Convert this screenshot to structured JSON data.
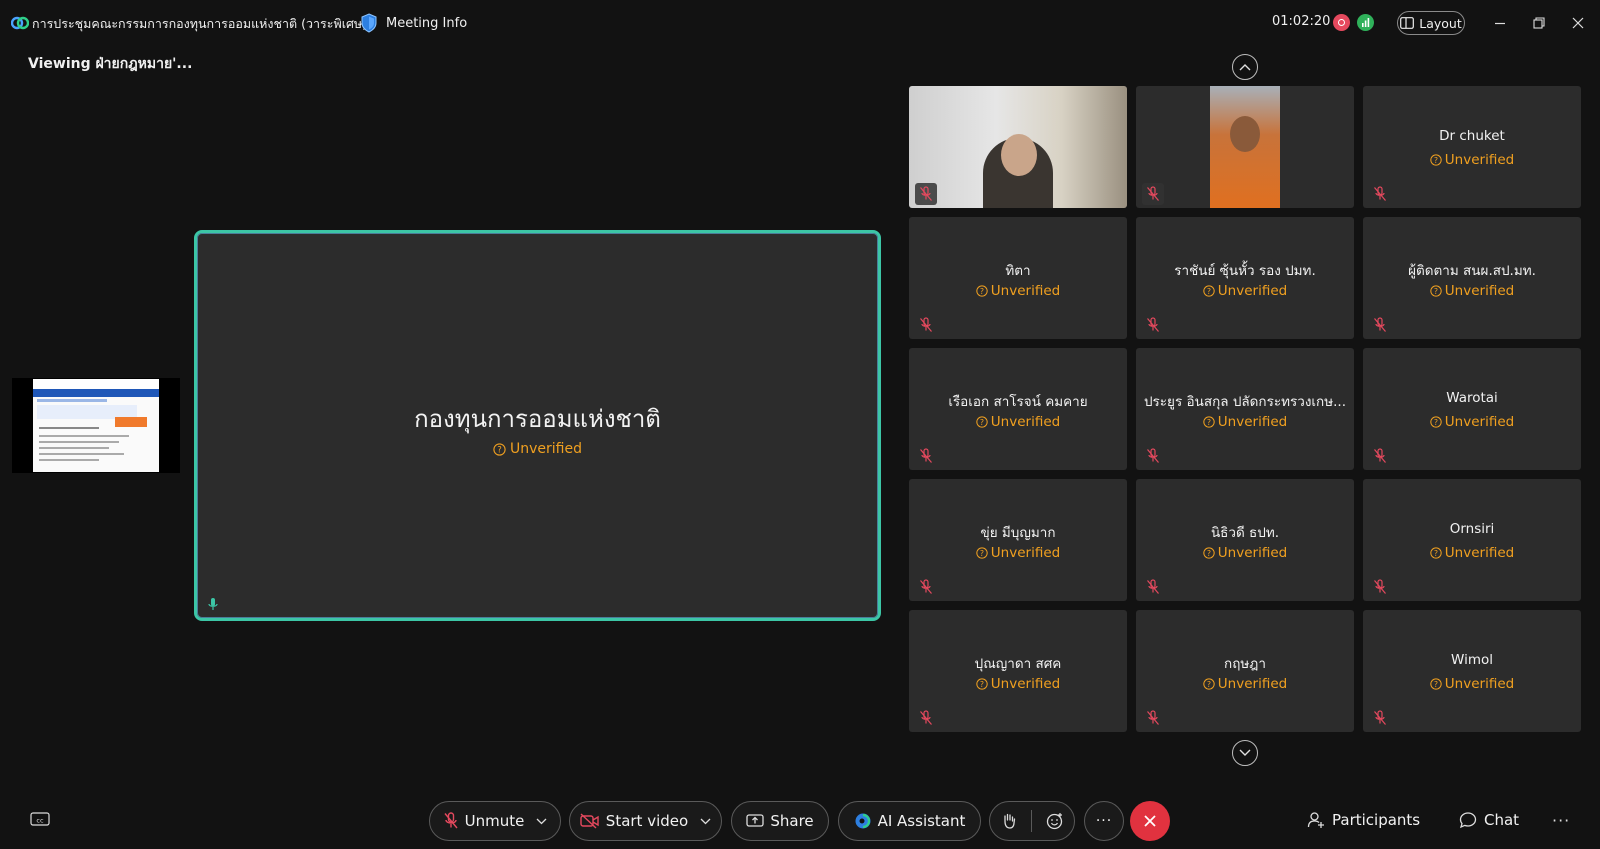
{
  "titlebar": {
    "window_title": "การประชุมคณะกรรมการกองทุนการออมแห่งชาติ (วาระพิเศษ)",
    "meeting_info_label": "Meeting Info",
    "timer": "01:02:20",
    "layout_label": "Layout"
  },
  "viewing_label": "Viewing ฝ่ายกฎหมาย'...",
  "stage": {
    "name": "กองทุนการออมแห่งชาติ",
    "status": "Unverified"
  },
  "participants": [
    {
      "name": "",
      "status": "",
      "video": true
    },
    {
      "name": "",
      "status": "",
      "video": true
    },
    {
      "name": "Dr chuket",
      "status": "Unverified"
    },
    {
      "name": "ทิตา",
      "status": "Unverified"
    },
    {
      "name": "ราชันย์ ซุ้นหั้ว รอง ปมท.",
      "status": "Unverified"
    },
    {
      "name": "ผู้ติดตาม สนผ.สป.มท.",
      "status": "Unverified"
    },
    {
      "name": "เรือเอก สาโรจน์ คมคาย",
      "status": "Unverified"
    },
    {
      "name": "ประยูร อินสกุล ปลัดกระทรวงเกษ...",
      "status": "Unverified"
    },
    {
      "name": "Warotai",
      "status": "Unverified"
    },
    {
      "name": "ขุ่ย  มีบุญมาก",
      "status": "Unverified"
    },
    {
      "name": "นิธิวดี ธปท.",
      "status": "Unverified"
    },
    {
      "name": "Ornsiri",
      "status": "Unverified"
    },
    {
      "name": "ปุณญาดา สศค",
      "status": "Unverified"
    },
    {
      "name": "กฤษฎา",
      "status": "Unverified"
    },
    {
      "name": "Wimol",
      "status": "Unverified"
    }
  ],
  "toolbar": {
    "unmute_label": "Unmute",
    "start_video_label": "Start video",
    "share_label": "Share",
    "ai_assistant_label": "AI Assistant",
    "participants_label": "Participants",
    "chat_label": "Chat",
    "more_label": "···"
  },
  "colors": {
    "accent_green": "#3cc6a6",
    "unverified": "#f0a020",
    "muted_red": "#e5495e",
    "end_call": "#e1323f"
  }
}
